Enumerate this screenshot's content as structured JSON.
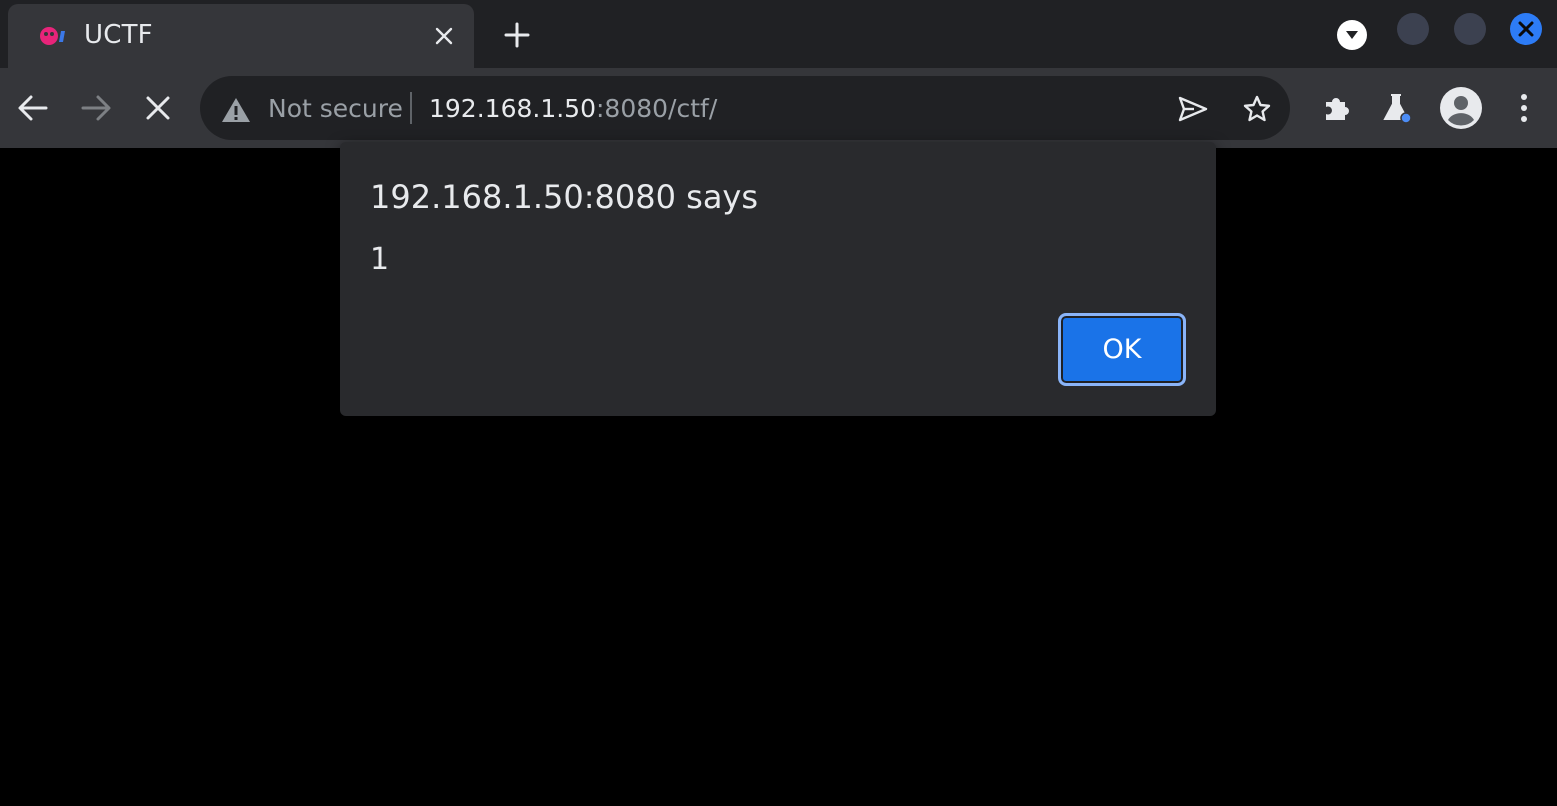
{
  "browser": {
    "tab": {
      "title": "UCTF",
      "favicon": "ctf-favicon",
      "close_icon": "close-icon"
    },
    "new_tab_icon": "plus-icon",
    "tab_search_icon": "chevron-down-icon",
    "window_controls": [
      "minimize",
      "maximize",
      "close"
    ],
    "toolbar": {
      "back_icon": "back-arrow-icon",
      "forward_icon": "forward-arrow-icon",
      "stop_icon": "stop-loading-icon",
      "security_label": "Not secure",
      "url_host": "192.168.1.50",
      "url_rest": ":8080/ctf/",
      "send_icon": "send-icon",
      "bookmark_icon": "star-icon",
      "extensions_icon": "puzzle-icon",
      "labs_icon": "flask-icon",
      "profile_icon": "avatar-icon",
      "menu_icon": "kebab-menu-icon"
    }
  },
  "dialog": {
    "title": "192.168.1.50:8080 says",
    "message": "1",
    "ok_label": "OK"
  },
  "colors": {
    "tabstrip_bg": "#202124",
    "toolbar_bg": "#35363a",
    "dialog_bg": "#292a2d",
    "accent": "#1a73e8",
    "favicon": "#e8247a",
    "window_close": "#2d7cf6"
  }
}
